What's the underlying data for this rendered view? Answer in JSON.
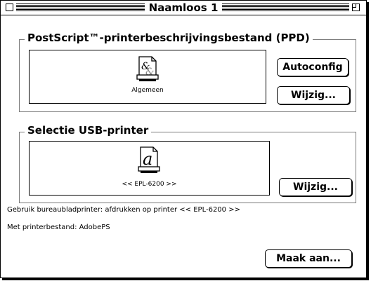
{
  "window": {
    "title": "Naamloos 1"
  },
  "ppd_group": {
    "label": "PostScript™-printerbeschrijvingsbestand (PPD)",
    "file_name": "Algemeen",
    "autoconfig_label": "Autoconfig",
    "change_label": "Wijzig..."
  },
  "usb_group": {
    "label": "Selectie USB-printer",
    "printer_name": "<< EPL-6200 >>",
    "change_label": "Wijzig..."
  },
  "info": {
    "line1": "Gebruik bureaubladprinter: afdrukken op printer << EPL-6200 >>",
    "line2": "Met printerbestand:  AdobePS"
  },
  "create_label": "Maak aan..."
}
